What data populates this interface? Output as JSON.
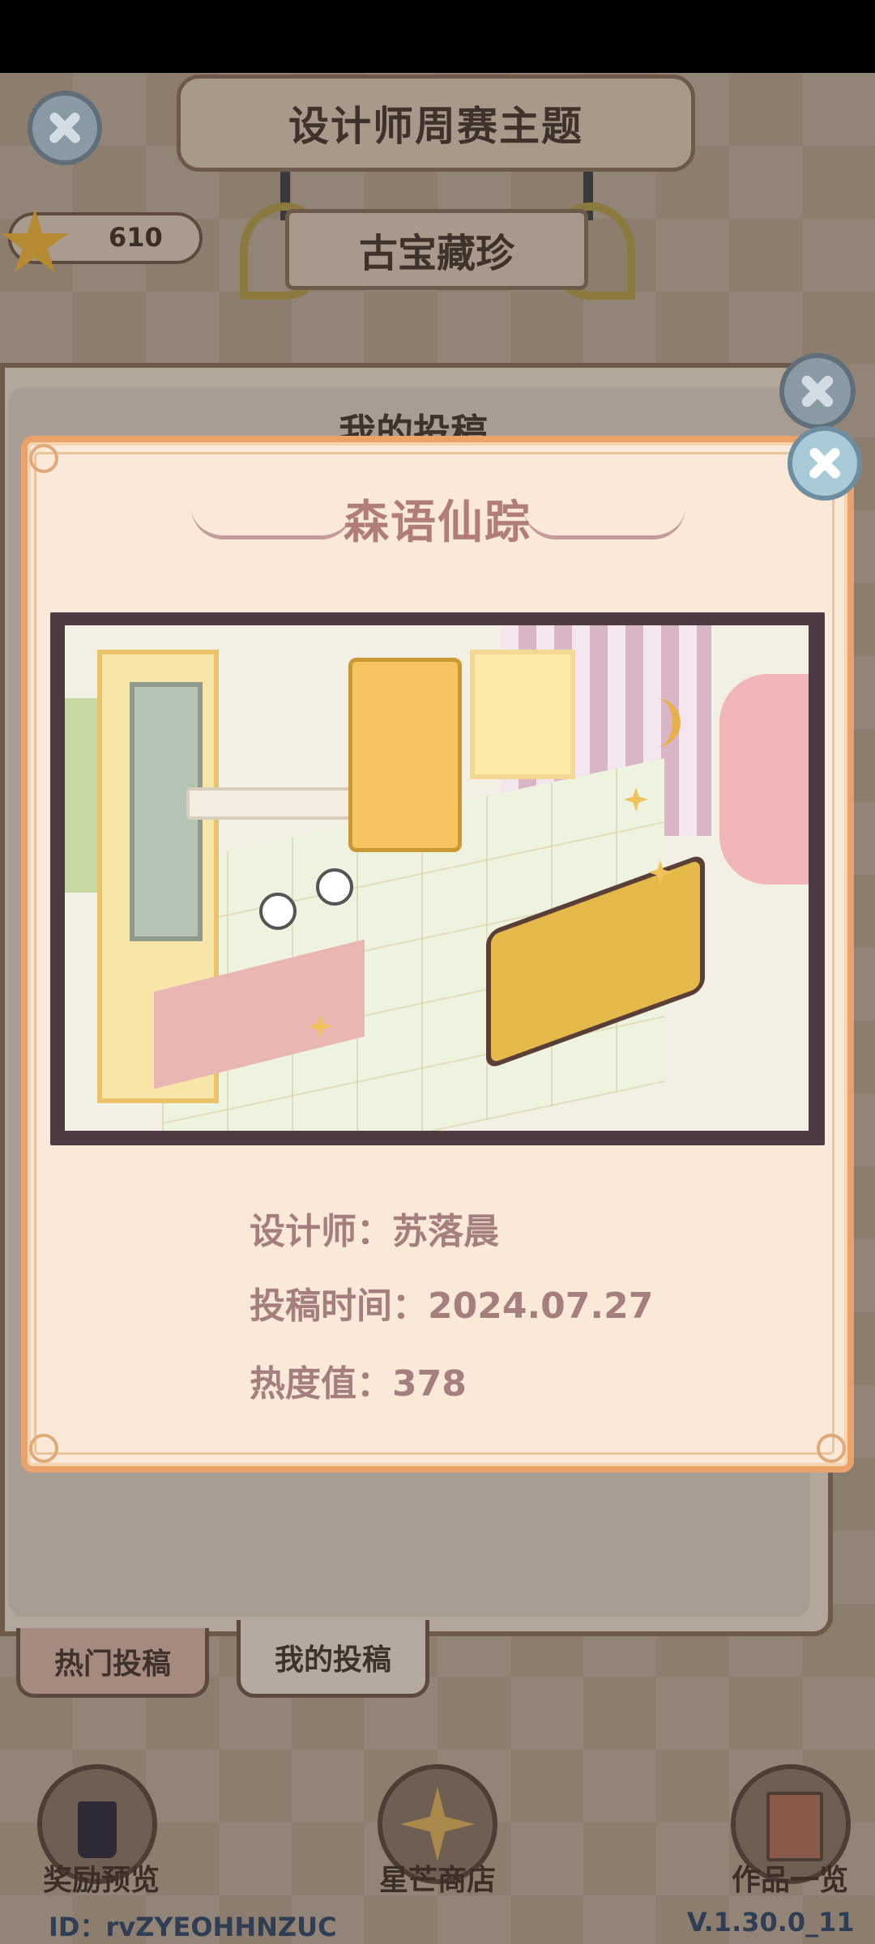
{
  "header": {
    "title": "设计师周赛主题",
    "theme": "古宝藏珍"
  },
  "currency": {
    "amount": "610"
  },
  "back_panel": {
    "heading": "我的投稿"
  },
  "tabs": [
    {
      "label": "热门投稿"
    },
    {
      "label": "我的投稿"
    }
  ],
  "bottom_nav": [
    {
      "label": "奖励预览",
      "icon": "trophy-icon"
    },
    {
      "label": "星芒商店",
      "icon": "star-shop-icon"
    },
    {
      "label": "作品一览",
      "icon": "book-icon"
    }
  ],
  "footer": {
    "id_text": "ID：rvZYEOHHNZUC",
    "version": "V.1.30.0_11"
  },
  "modal": {
    "title": "森语仙踪",
    "designer_label": "设计师：",
    "designer": "苏落晨",
    "time_label": "投稿时间：",
    "time": "2024.07.27",
    "heat_label": "热度值：",
    "heat": "378"
  },
  "colors": {
    "modal_bg": "#fae8d8",
    "modal_border": "#e8a26a",
    "accent_text": "#a47f7d",
    "close_btn": "#a9cbd8"
  }
}
